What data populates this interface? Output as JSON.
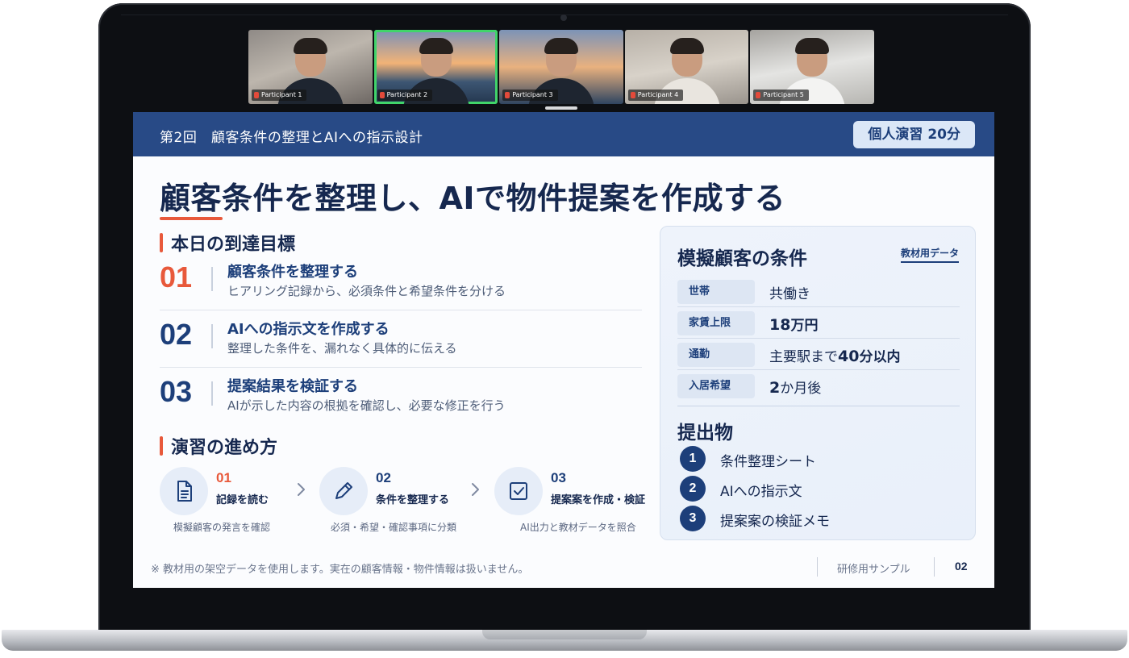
{
  "video_call": {
    "participants": [
      {
        "name": "Participant 1",
        "active": false
      },
      {
        "name": "Participant 2",
        "active": true
      },
      {
        "name": "Participant 3",
        "active": false
      },
      {
        "name": "Participant 4",
        "active": false
      },
      {
        "name": "Participant 5",
        "active": false
      }
    ]
  },
  "slide": {
    "header": {
      "session": "第2回　顧客条件の整理とAIへの指示設計",
      "badge": "個人演習 20分"
    },
    "title": "顧客条件を整理し、AIで物件提案を作成する",
    "goals_heading": "本日の到達目標",
    "goals": [
      {
        "num": "01",
        "title": "顧客条件を整理する",
        "desc": "ヒアリング記録から、必須条件と希望条件を分ける"
      },
      {
        "num": "02",
        "title": "AIへの指示文を作成する",
        "desc": "整理した条件を、漏れなく具体的に伝える"
      },
      {
        "num": "03",
        "title": "提案結果を検証する",
        "desc": "AIが示した内容の根拠を確認し、必要な修正を行う"
      }
    ],
    "steps_heading": "演習の進め方",
    "steps": [
      {
        "num": "01",
        "label": "記録を読む",
        "caption": "模擬顧客の発言を確認",
        "icon": "document-icon"
      },
      {
        "num": "02",
        "label": "条件を整理する",
        "caption": "必須・希望・確認事項に分類",
        "icon": "pencil-icon"
      },
      {
        "num": "03",
        "label": "提案案を作成・検証",
        "caption": "AI出力と教材データを照合",
        "icon": "checkbox-icon"
      }
    ],
    "customer": {
      "title": "模擬顧客の条件",
      "link": "教材用データ",
      "rows": [
        {
          "key": "世帯",
          "value_pre": "共働き",
          "value_bold": "",
          "value_post": ""
        },
        {
          "key": "家賃上限",
          "value_pre": "",
          "value_bold": "18",
          "value_post": "万円"
        },
        {
          "key": "通勤",
          "value_pre": "主要駅まで",
          "value_bold": "40",
          "value_post": "分以内"
        },
        {
          "key": "入居希望",
          "value_pre": "",
          "value_bold": "2",
          "value_post": "か月後"
        }
      ]
    },
    "deliverables": {
      "title": "提出物",
      "items": [
        {
          "num": "1",
          "label": "条件整理シート"
        },
        {
          "num": "2",
          "label": "AIへの指示文"
        },
        {
          "num": "3",
          "label": "提案案の検証メモ"
        }
      ]
    },
    "footer": {
      "note": "※ 教材用の架空データを使用します。実在の顧客情報・物件情報は扱いません。",
      "sample": "研修用サンプル",
      "page": "02"
    }
  },
  "colors": {
    "header_bg": "#284a86",
    "accent": "#e8593b",
    "navy": "#1d3f7a",
    "active_speaker": "#41d46a"
  }
}
